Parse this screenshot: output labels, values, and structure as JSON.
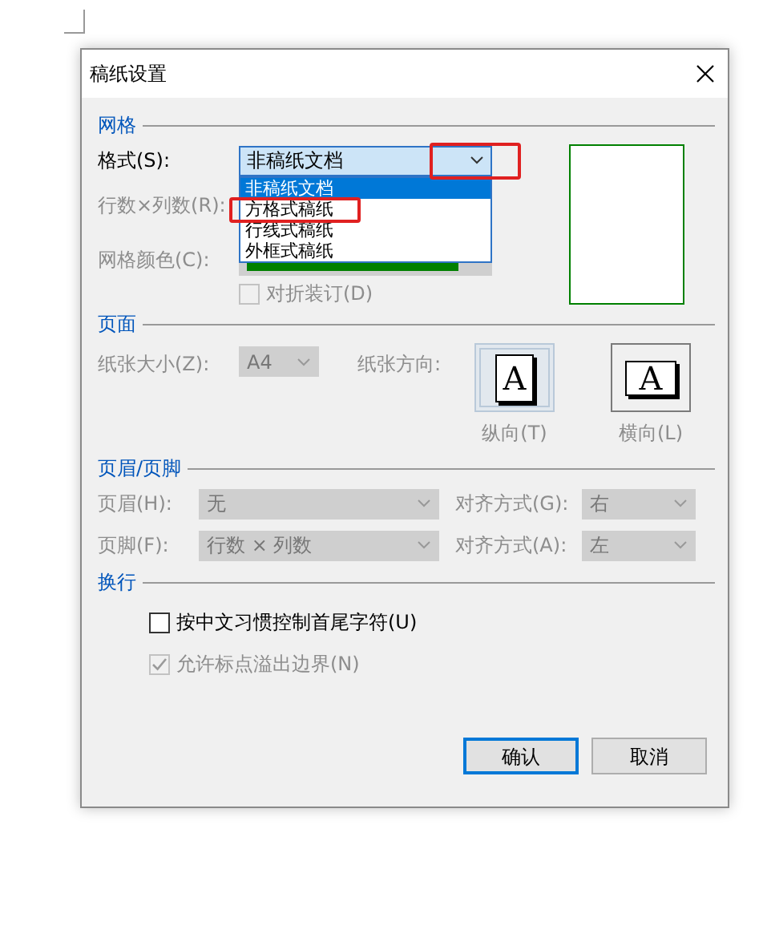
{
  "dialog": {
    "title": "稿纸设置"
  },
  "grid": {
    "heading": "网格",
    "format": {
      "label": "格式(S):",
      "value": "非稿纸文档",
      "expanded": true,
      "arrow_highlighted": true,
      "options": [
        {
          "label": "非稿纸文档",
          "selected": true,
          "highlighted": false
        },
        {
          "label": "方格式稿纸",
          "selected": false,
          "highlighted": true
        },
        {
          "label": "行线式稿纸",
          "selected": false,
          "highlighted": false
        },
        {
          "label": "外框式稿纸",
          "selected": false,
          "highlighted": false
        }
      ]
    },
    "rows_cols": {
      "label": "行数×列数(R):",
      "disabled": true
    },
    "grid_color": {
      "label": "网格颜色(C):",
      "disabled": true,
      "color": "#008000"
    },
    "fold": {
      "label": "对折装订(D)",
      "checked": false,
      "disabled": true
    },
    "preview": {
      "color": "#008000"
    }
  },
  "page": {
    "heading": "页面",
    "paper_size": {
      "label": "纸张大小(Z):",
      "value": "A4",
      "disabled": true
    },
    "orientation_label": "纸张方向:",
    "orientations": [
      {
        "kind": "portrait",
        "glyph": "A",
        "label": "纵向(T)",
        "selected": true
      },
      {
        "kind": "landscape",
        "glyph": "A",
        "label": "横向(L)",
        "selected": false
      }
    ]
  },
  "header_footer": {
    "heading": "页眉/页脚",
    "disabled": true,
    "rows": [
      {
        "label": "页眉(H):",
        "value": "无",
        "align_label": "对齐方式(G):",
        "align_value": "右"
      },
      {
        "label": "页脚(F):",
        "value": "行数 × 列数",
        "align_label": "对齐方式(A):",
        "align_value": "左"
      }
    ]
  },
  "line_break": {
    "heading": "换行",
    "options": [
      {
        "label": "按中文习惯控制首尾字符(U)",
        "checked": false,
        "disabled": false
      },
      {
        "label": "允许标点溢出边界(N)",
        "checked": true,
        "disabled": true
      }
    ]
  },
  "buttons": [
    {
      "label": "确认",
      "default": true
    },
    {
      "label": "取消",
      "default": false
    }
  ]
}
